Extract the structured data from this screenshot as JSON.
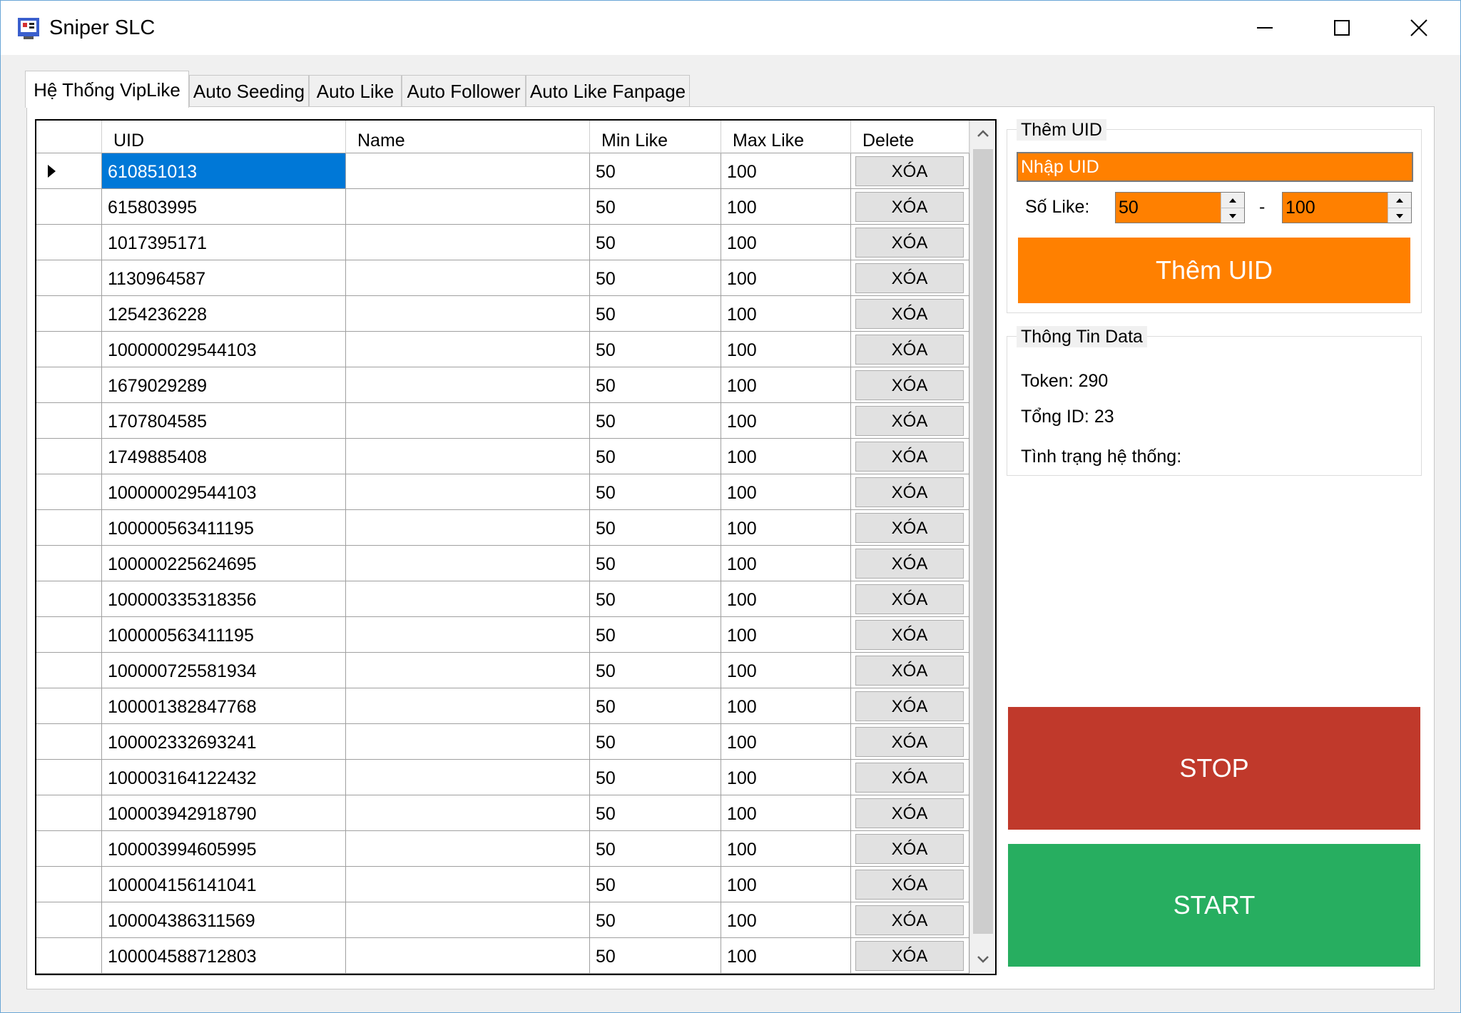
{
  "window": {
    "title": "Sniper SLC"
  },
  "tabs": [
    {
      "label": "Hệ Thống VipLike",
      "active": true
    },
    {
      "label": "Auto Seeding",
      "active": false
    },
    {
      "label": "Auto Like",
      "active": false
    },
    {
      "label": "Auto Follower",
      "active": false
    },
    {
      "label": "Auto Like Fanpage",
      "active": false
    }
  ],
  "grid": {
    "columns": [
      "UID",
      "Name",
      "Min Like",
      "Max Like",
      "Delete"
    ],
    "delete_label": "XÓA",
    "selected_row": 0,
    "rows": [
      {
        "uid": "610851013",
        "name": "",
        "min": "50",
        "max": "100"
      },
      {
        "uid": "615803995",
        "name": "",
        "min": "50",
        "max": "100"
      },
      {
        "uid": "1017395171",
        "name": "",
        "min": "50",
        "max": "100"
      },
      {
        "uid": "1130964587",
        "name": "",
        "min": "50",
        "max": "100"
      },
      {
        "uid": "1254236228",
        "name": "",
        "min": "50",
        "max": "100"
      },
      {
        "uid": "100000029544103",
        "name": "",
        "min": "50",
        "max": "100"
      },
      {
        "uid": "1679029289",
        "name": "",
        "min": "50",
        "max": "100"
      },
      {
        "uid": "1707804585",
        "name": "",
        "min": "50",
        "max": "100"
      },
      {
        "uid": "1749885408",
        "name": "",
        "min": "50",
        "max": "100"
      },
      {
        "uid": "100000029544103",
        "name": "",
        "min": "50",
        "max": "100"
      },
      {
        "uid": "100000563411195",
        "name": "",
        "min": "50",
        "max": "100"
      },
      {
        "uid": "100000225624695",
        "name": "",
        "min": "50",
        "max": "100"
      },
      {
        "uid": "100000335318356",
        "name": "",
        "min": "50",
        "max": "100"
      },
      {
        "uid": "100000563411195",
        "name": "",
        "min": "50",
        "max": "100"
      },
      {
        "uid": "100000725581934",
        "name": "",
        "min": "50",
        "max": "100"
      },
      {
        "uid": "100001382847768",
        "name": "",
        "min": "50",
        "max": "100"
      },
      {
        "uid": "100002332693241",
        "name": "",
        "min": "50",
        "max": "100"
      },
      {
        "uid": "100003164122432",
        "name": "",
        "min": "50",
        "max": "100"
      },
      {
        "uid": "100003942918790",
        "name": "",
        "min": "50",
        "max": "100"
      },
      {
        "uid": "100003994605995",
        "name": "",
        "min": "50",
        "max": "100"
      },
      {
        "uid": "100004156141041",
        "name": "",
        "min": "50",
        "max": "100"
      },
      {
        "uid": "100004386311569",
        "name": "",
        "min": "50",
        "max": "100"
      },
      {
        "uid": "100004588712803",
        "name": "",
        "min": "50",
        "max": "100"
      }
    ]
  },
  "add_uid": {
    "group_label": "Thêm UID",
    "placeholder": "Nhập UID",
    "so_like_label": "Số Like:",
    "min_value": "50",
    "dash": "-",
    "max_value": "100",
    "button_label": "Thêm UID"
  },
  "info": {
    "group_label": "Thông Tin Data",
    "token": "Token: 290",
    "total": "Tổng ID: 23",
    "status": "Tình trạng hệ thống:"
  },
  "actions": {
    "stop_label": "STOP",
    "start_label": "START"
  },
  "colors": {
    "accent_orange": "#ff8000",
    "stop_red": "#c0392b",
    "start_green": "#27ae60",
    "selection_blue": "#0078d7"
  }
}
